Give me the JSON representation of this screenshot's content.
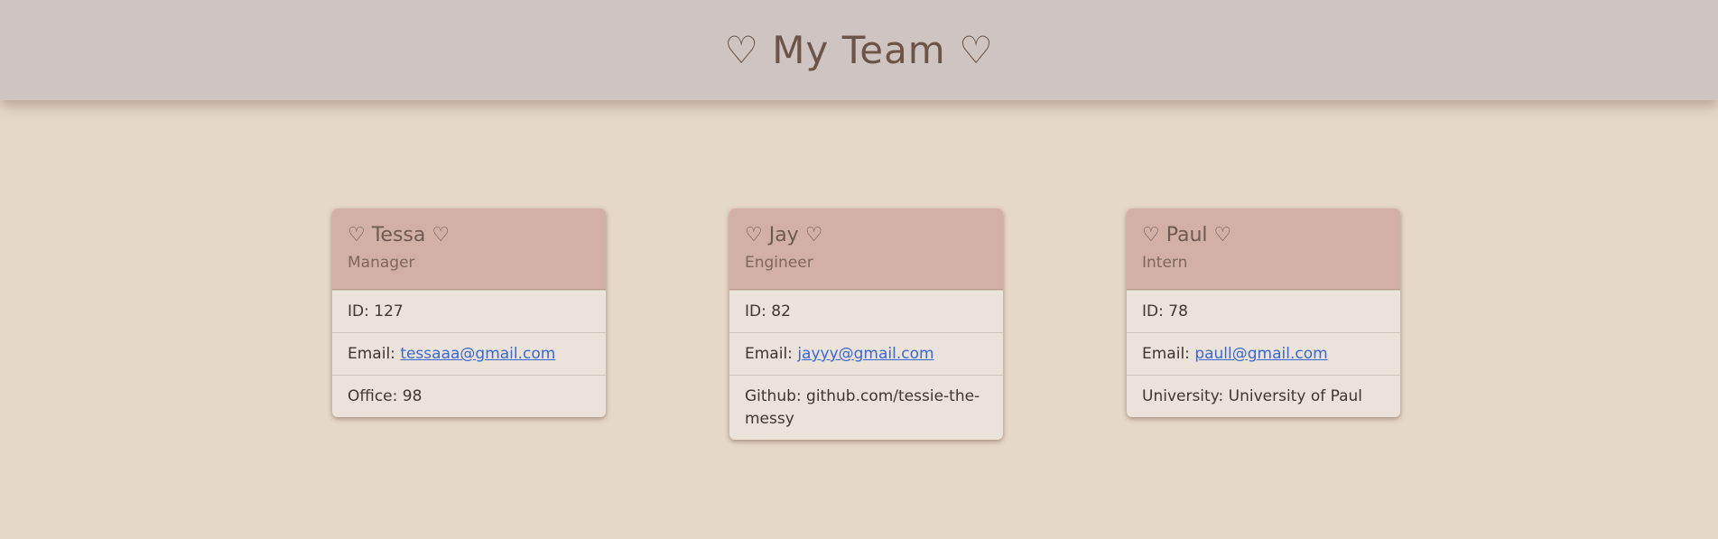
{
  "header": {
    "title": "♡ My Team ♡"
  },
  "team": [
    {
      "name": "♡ Tessa ♡",
      "role": "Manager",
      "id_label": "ID:",
      "id": "127",
      "email_label": "Email:",
      "email": "tessaaa@gmail.com",
      "extra_label": "Office:",
      "extra": "98"
    },
    {
      "name": "♡ Jay ♡",
      "role": "Engineer",
      "id_label": "ID:",
      "id": "82",
      "email_label": "Email:",
      "email": "jayyy@gmail.com",
      "extra_label": "Github:",
      "extra": "github.com/tessie-the-messy"
    },
    {
      "name": "♡ Paul ♡",
      "role": "Intern",
      "id_label": "ID:",
      "id": "78",
      "email_label": "Email:",
      "email": "paull@gmail.com",
      "extra_label": "University:",
      "extra": "University of Paul"
    }
  ],
  "colors": {
    "page_background": "#e6d8c7",
    "header_background": "#cec4c2",
    "card_header": "#d3b0a6",
    "card_body": "#ebe3d9",
    "link": "#3a67d6"
  }
}
